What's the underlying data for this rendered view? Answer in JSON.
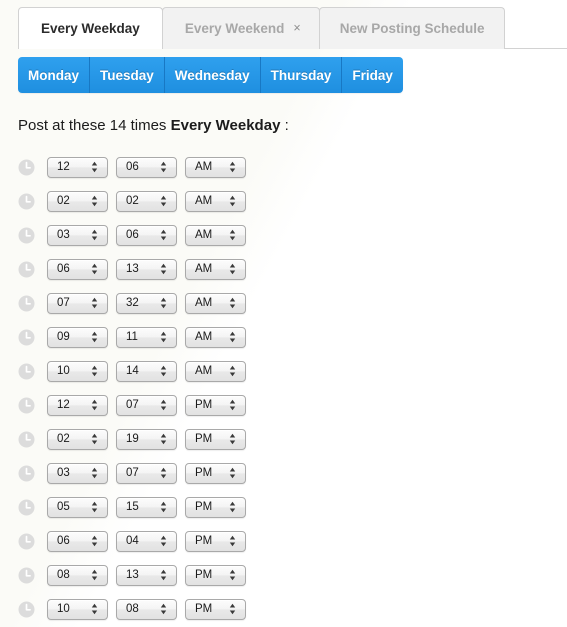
{
  "tabs": [
    {
      "label": "Every Weekday",
      "state": "active",
      "closable": false
    },
    {
      "label": "Every Weekend",
      "state": "inactive",
      "closable": true,
      "close_glyph": "×"
    },
    {
      "label": "New Posting Schedule",
      "state": "inactive",
      "closable": false
    }
  ],
  "days": [
    {
      "label": "Monday",
      "selected": true
    },
    {
      "label": "Tuesday",
      "selected": true
    },
    {
      "label": "Wednesday",
      "selected": true
    },
    {
      "label": "Thursday",
      "selected": true
    },
    {
      "label": "Friday",
      "selected": true
    }
  ],
  "heading": {
    "prefix": "Post at these ",
    "count": "14",
    "middle": " times ",
    "schedule_name": "Every Weekday",
    "suffix": " :",
    "full_text": "Post at these 14 times Every Weekday :"
  },
  "times": [
    {
      "hour": "12",
      "minute": "06",
      "meridiem": "AM"
    },
    {
      "hour": "02",
      "minute": "02",
      "meridiem": "AM"
    },
    {
      "hour": "03",
      "minute": "06",
      "meridiem": "AM"
    },
    {
      "hour": "06",
      "minute": "13",
      "meridiem": "AM"
    },
    {
      "hour": "07",
      "minute": "32",
      "meridiem": "AM"
    },
    {
      "hour": "09",
      "minute": "11",
      "meridiem": "AM"
    },
    {
      "hour": "10",
      "minute": "14",
      "meridiem": "AM"
    },
    {
      "hour": "12",
      "minute": "07",
      "meridiem": "PM"
    },
    {
      "hour": "02",
      "minute": "19",
      "meridiem": "PM"
    },
    {
      "hour": "03",
      "minute": "07",
      "meridiem": "PM"
    },
    {
      "hour": "05",
      "minute": "15",
      "meridiem": "PM"
    },
    {
      "hour": "06",
      "minute": "04",
      "meridiem": "PM"
    },
    {
      "hour": "08",
      "minute": "13",
      "meridiem": "PM"
    },
    {
      "hour": "10",
      "minute": "08",
      "meridiem": "PM"
    }
  ],
  "colors": {
    "day_button_blue": "#2296e8",
    "day_button_border": "#1878c4",
    "active_tab_text": "#2b2b2b",
    "inactive_tab_text": "#a8a8a8",
    "inactive_tab_bg": "#f2f2f2",
    "clock_icon": "#dcdcdc",
    "page_bg": "#ffffff"
  },
  "icons": {
    "clock": "clock-icon",
    "stepper": "up-down-stepper-icon",
    "close": "close-icon"
  }
}
